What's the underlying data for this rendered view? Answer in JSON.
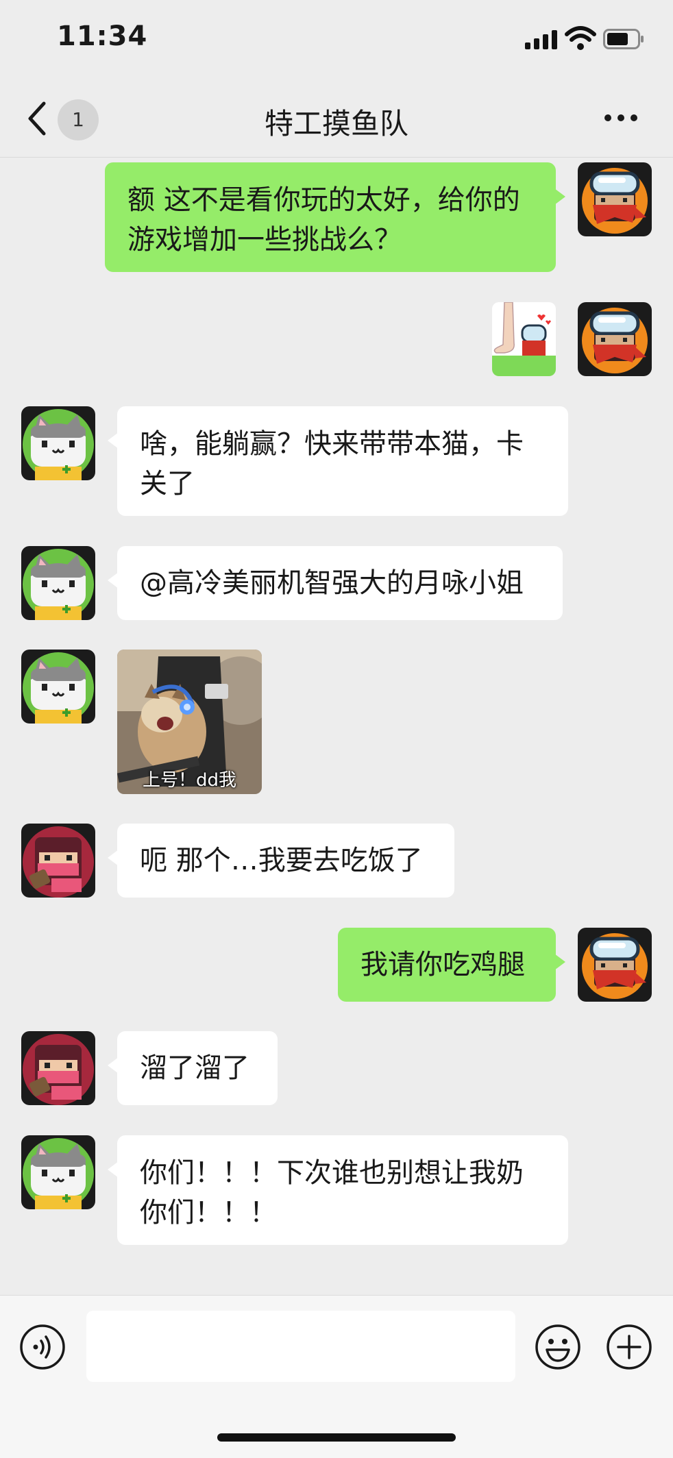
{
  "status_bar": {
    "time": "11:34"
  },
  "nav": {
    "unread_count": "1",
    "title": "特工摸鱼队"
  },
  "messages": [
    {
      "sender": "me",
      "text": "额 这不是看你玩的太好，给你的游戏增加一些挑战么？"
    },
    {
      "sender": "me",
      "type": "sticker"
    },
    {
      "sender": "cat",
      "text": "啥，能躺赢？快来带带本猫，卡关了"
    },
    {
      "sender": "cat",
      "text": "@高冷美丽机智强大的月咏小姐"
    },
    {
      "sender": "cat",
      "type": "sticker",
      "caption": "上号！dd我"
    },
    {
      "sender": "ninja",
      "text": "呃 那个…我要去吃饭了"
    },
    {
      "sender": "me",
      "text": "我请你吃鸡腿"
    },
    {
      "sender": "ninja",
      "text": "溜了溜了"
    },
    {
      "sender": "cat",
      "text": "你们！！！下次谁也别想让我奶你们！！！"
    }
  ],
  "colors": {
    "my_bubble": "#95ec69",
    "their_bubble": "#ffffff",
    "background": "#ededed"
  },
  "icons": [
    "back-icon",
    "more-icon",
    "voice-icon",
    "emoji-icon",
    "plus-icon"
  ]
}
